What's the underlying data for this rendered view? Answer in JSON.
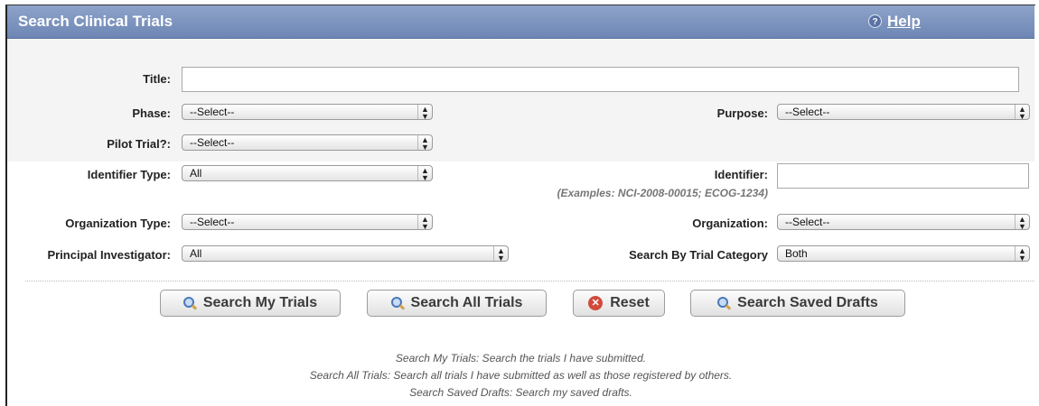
{
  "header": {
    "title": "Search Clinical Trials",
    "help_label": "Help",
    "help_icon": "question-circle-icon"
  },
  "form": {
    "title_label": "Title:",
    "title_value": "",
    "phase_label": "Phase:",
    "phase_value": "--Select--",
    "purpose_label": "Purpose:",
    "purpose_value": "--Select--",
    "pilot_label": "Pilot Trial?:",
    "pilot_value": "--Select--",
    "identifier_type_label": "Identifier Type:",
    "identifier_type_value": "All",
    "identifier_label": "Identifier:",
    "identifier_value": "",
    "identifier_hint": "(Examples: NCI-2008-00015; ECOG-1234)",
    "org_type_label": "Organization Type:",
    "org_type_value": "--Select--",
    "organization_label": "Organization:",
    "organization_value": "--Select--",
    "pi_label": "Principal Investigator:",
    "pi_value": "All",
    "trial_category_label": "Search By Trial Category",
    "trial_category_value": "Both"
  },
  "buttons": {
    "search_my": "Search My Trials",
    "search_all": "Search All Trials",
    "reset": "Reset",
    "search_drafts": "Search Saved Drafts"
  },
  "notes": [
    "Search My Trials: Search the trials I have submitted.",
    "Search All Trials: Search all trials I have submitted as well as those registered by others.",
    "Search Saved Drafts: Search my saved drafts."
  ]
}
